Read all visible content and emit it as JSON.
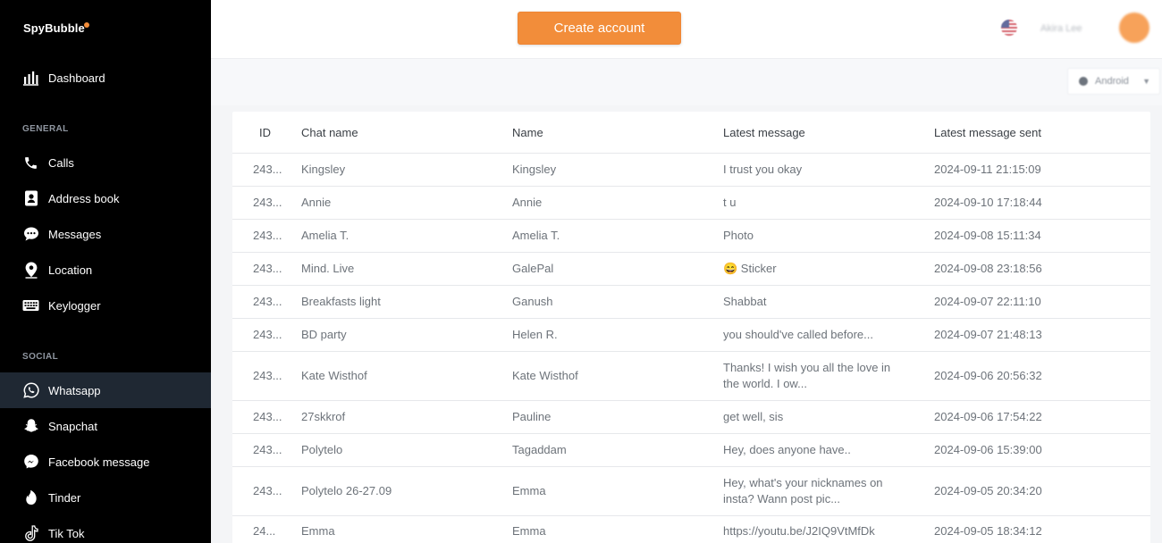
{
  "brand": {
    "name": "SpyBubble",
    "accent": "#f28d3a"
  },
  "sidebar": {
    "dashboard": {
      "label": "Dashboard",
      "icon": "bar-chart-icon"
    },
    "general_label": "GENERAL",
    "general_items": [
      {
        "label": "Calls",
        "icon": "phone-icon"
      },
      {
        "label": "Address book",
        "icon": "address-book-icon"
      },
      {
        "label": "Messages",
        "icon": "message-bubble-icon"
      },
      {
        "label": "Location",
        "icon": "location-pin-icon"
      },
      {
        "label": "Keylogger",
        "icon": "keyboard-icon"
      }
    ],
    "social_label": "SOCIAL",
    "social_items": [
      {
        "label": "Whatsapp",
        "icon": "whatsapp-icon",
        "active": true
      },
      {
        "label": "Snapchat",
        "icon": "snapchat-icon"
      },
      {
        "label": "Facebook message",
        "icon": "messenger-icon"
      },
      {
        "label": "Tinder",
        "icon": "tinder-flame-icon"
      },
      {
        "label": "Tik Tok",
        "icon": "tiktok-icon"
      }
    ]
  },
  "topbar": {
    "create_account_label": "Create account",
    "flag_icon": "us-flag-icon",
    "user_name": "Akira Lee",
    "avatar_color": "#f7a25a"
  },
  "subheader": {
    "device_label": "Android",
    "device_icon": "android-icon"
  },
  "table": {
    "columns": [
      "ID",
      "Chat name",
      "Name",
      "Latest message",
      "Latest message sent"
    ],
    "rows": [
      {
        "id": "243...",
        "chat_name": "Kingsley",
        "name": "Kingsley",
        "latest_message": "I trust you okay",
        "sent": "2024-09-11 21:15:09"
      },
      {
        "id": "243...",
        "chat_name": "Annie",
        "name": "Annie",
        "latest_message": "t u",
        "sent": "2024-09-10 17:18:44"
      },
      {
        "id": "243...",
        "chat_name": "Amelia T.",
        "name": "Amelia T.",
        "latest_message": "Photo",
        "sent": "2024-09-08 15:11:34"
      },
      {
        "id": "243...",
        "chat_name": "Mind. Live",
        "name": "GalePal",
        "latest_message": "😄 Sticker",
        "sent": "2024-09-08 23:18:56"
      },
      {
        "id": "243...",
        "chat_name": "Breakfasts light",
        "name": "Ganush",
        "latest_message": "Shabbat",
        "sent": "2024-09-07 22:11:10"
      },
      {
        "id": "243...",
        "chat_name": "BD party",
        "name": "Helen R.",
        "latest_message": "you should've called before...",
        "sent": "2024-09-07 21:48:13"
      },
      {
        "id": "243...",
        "chat_name": "Kate Wisthof",
        "name": "Kate Wisthof",
        "latest_message": "Thanks! I wish you all the love in the world. I ow...",
        "sent": "2024-09-06 20:56:32"
      },
      {
        "id": "243...",
        "chat_name": "27skkrof",
        "name": "Pauline",
        "latest_message": "get well, sis",
        "sent": "2024-09-06 17:54:22"
      },
      {
        "id": "243...",
        "chat_name": "Polytelo",
        "name": "Tagaddam",
        "latest_message": "Hey, does anyone have..",
        "sent": "2024-09-06 15:39:00"
      },
      {
        "id": "243...",
        "chat_name": "Polytelo 26-27.09",
        "name": "Emma",
        "latest_message": "Hey, what's your nicknames on insta? Wann post pic...",
        "sent": "2024-09-05 20:34:20"
      },
      {
        "id": "24...",
        "chat_name": "Emma",
        "name": "Emma",
        "latest_message": "https://youtu.be/J2IQ9VtMfDk",
        "sent": "2024-09-05 18:34:12"
      }
    ]
  }
}
